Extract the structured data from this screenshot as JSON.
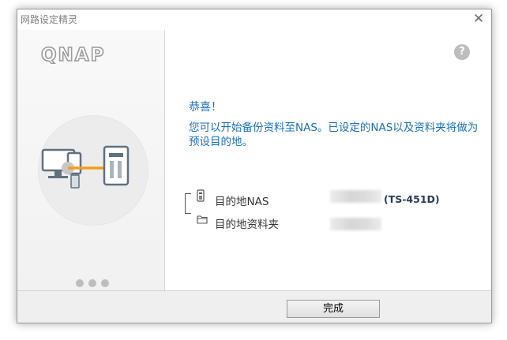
{
  "window": {
    "title": "网路设定精灵"
  },
  "brand": {
    "logo": "QNAP"
  },
  "content": {
    "congrats": "恭喜！",
    "message": "您可以开始备份资料至NAS。已设定的NAS以及资料夹将做为预设目的地。",
    "destination_nas_label": "目的地NAS",
    "destination_nas_model": "(TS-451D)",
    "destination_folder_label": "目的地资料夹"
  },
  "footer": {
    "finish_label": "完成"
  },
  "colors": {
    "accent_text": "#1a6fbf",
    "orange": "#f39c1f"
  },
  "icons": [
    "close-icon",
    "help-icon",
    "nas-icon",
    "folder-icon",
    "computer-icon",
    "nas-device-icon"
  ]
}
